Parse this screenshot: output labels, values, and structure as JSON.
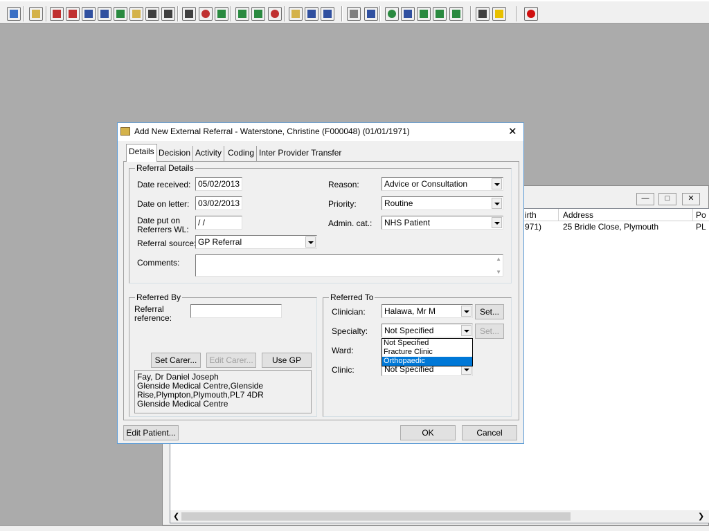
{
  "toolbar": {
    "icons": [
      {
        "name": "user-icon",
        "color": "#3a6fc4"
      },
      {
        "name": "printer-icon",
        "color": "#d4b24a"
      },
      {
        "name": "book-icon",
        "color": "#c03030"
      },
      {
        "name": "folder-edit-icon",
        "color": "#c03030"
      },
      {
        "name": "patient-list-icon",
        "color": "#3050a0"
      },
      {
        "name": "letter-m-icon",
        "color": "#3050a0"
      },
      {
        "name": "person-green-icon",
        "color": "#2a8a40"
      },
      {
        "name": "notes-icon",
        "color": "#d4b24a"
      },
      {
        "name": "camera-icon",
        "color": "#404040"
      },
      {
        "name": "camera-alt-icon",
        "color": "#404040"
      },
      {
        "name": "search-icon",
        "color": "#404040"
      },
      {
        "name": "clock-icon",
        "color": "#c03030"
      },
      {
        "name": "screen-icon",
        "color": "#2a8a40"
      },
      {
        "name": "calendar-icon",
        "color": "#2a8a40"
      },
      {
        "name": "calendar-alt-icon",
        "color": "#2a8a40"
      },
      {
        "name": "timer-icon",
        "color": "#c03030"
      },
      {
        "name": "document-icon",
        "color": "#d4b24a"
      },
      {
        "name": "tray-icon",
        "color": "#3050a0"
      },
      {
        "name": "inbox-icon",
        "color": "#3050a0"
      },
      {
        "name": "page-icon",
        "color": "#808080"
      },
      {
        "name": "bar-chart-icon",
        "color": "#3050a0"
      },
      {
        "name": "globe-icon",
        "color": "#2a8a40"
      },
      {
        "name": "mail-icon",
        "color": "#3050a0"
      },
      {
        "name": "mail-down-icon",
        "color": "#2a8a40"
      },
      {
        "name": "mail-send-icon",
        "color": "#2a8a40"
      },
      {
        "name": "mail-receive-icon",
        "color": "#2a8a40"
      },
      {
        "name": "transfer-icon",
        "color": "#404040"
      },
      {
        "name": "warning-icon",
        "color": "#e8c000"
      },
      {
        "name": "exit-icon",
        "color": "#d01010"
      }
    ]
  },
  "background_window": {
    "columns": [
      "irth",
      "Address",
      "Po"
    ],
    "row": [
      "971)",
      "25 Bridle Close, Plymouth",
      "PL"
    ]
  },
  "dialog": {
    "title": "Add New External Referral - Waterstone, Christine (F000048) (01/01/1971)",
    "tabs": [
      "Details",
      "Decision",
      "Activity",
      "Coding",
      "Inter Provider Transfer"
    ],
    "referral_details": {
      "group_title": "Referral Details",
      "date_received_label": "Date received:",
      "date_received": "05/02/2013",
      "date_on_letter_label": "Date on letter:",
      "date_on_letter": "03/02/2013",
      "date_put_on_label_1": "Date put on",
      "date_put_on_label_2": "Referrers WL:",
      "date_put_on": " /  /",
      "referral_source_label": "Referral source:",
      "referral_source": "GP Referral",
      "reason_label": "Reason:",
      "reason": "Advice or Consultation",
      "priority_label": "Priority:",
      "priority": "Routine",
      "admin_cat_label": "Admin. cat.:",
      "admin_cat": "NHS Patient",
      "comments_label": "Comments:"
    },
    "referred_by": {
      "group_title": "Referred By",
      "referral_reference_label_1": "Referral",
      "referral_reference_label_2": "reference:",
      "set_carer": "Set Carer...",
      "edit_carer": "Edit Carer...",
      "use_gp": "Use GP",
      "gp_lines": [
        "Fay, Dr Daniel Joseph",
        "Glenside Medical Centre,Glenside",
        "Rise,Plympton,Plymouth,PL7 4DR",
        "Glenside Medical Centre"
      ]
    },
    "referred_to": {
      "group_title": "Referred To",
      "clinician_label": "Clinician:",
      "clinician": "Halawa, Mr M",
      "specialty_label": "Specialty:",
      "specialty": "Not Specified",
      "ward_label": "Ward:",
      "clinic_label": "Clinic:",
      "clinic": "Not Specified",
      "set_button": "Set...",
      "set_button_disabled": "Set...",
      "dropdown_options": [
        "Not Specified",
        "Fracture Clinic",
        "Orthopaedic"
      ],
      "dropdown_selected_index": 2
    },
    "buttons": {
      "edit_patient": "Edit Patient...",
      "ok": "OK",
      "cancel": "Cancel"
    }
  }
}
